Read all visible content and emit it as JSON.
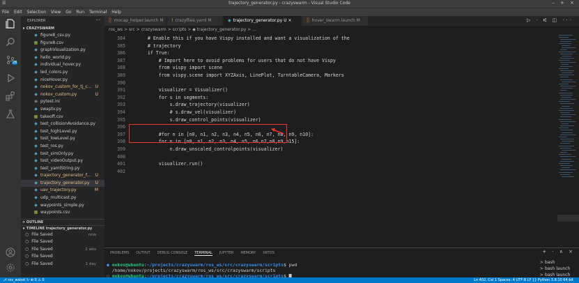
{
  "window": {
    "title": "trajectory_generator.py - crazyswarm - Visual Studio Code",
    "controls": "– + ×"
  },
  "menu": [
    "File",
    "Edit",
    "Selection",
    "View",
    "Go",
    "Run",
    "Terminal",
    "Help"
  ],
  "activity_bar": [
    "explorer-icon",
    "search-icon",
    "source-control-icon",
    "run-debug-icon",
    "extensions-icon",
    "testing-icon",
    "account-icon",
    "settings-gear-icon"
  ],
  "explorer": {
    "header": "EXPLORER",
    "more": "···",
    "root": "∨ CRAZYSWARM",
    "files": [
      {
        "name": "figure8_csv.py",
        "icon": "◆",
        "color": "#519aba",
        "badge": ""
      },
      {
        "name": "figure8.csv",
        "icon": "▦",
        "color": "#8dc149",
        "badge": ""
      },
      {
        "name": "graphVisualization.py",
        "icon": "◆",
        "color": "#519aba",
        "badge": ""
      },
      {
        "name": "hello_world.py",
        "icon": "◆",
        "color": "#519aba",
        "badge": ""
      },
      {
        "name": "individual_hover.py",
        "icon": "◆",
        "color": "#519aba",
        "badge": ""
      },
      {
        "name": "led_colors.py",
        "icon": "◆",
        "color": "#519aba",
        "badge": ""
      },
      {
        "name": "niceHover.py",
        "icon": "◆",
        "color": "#519aba",
        "badge": ""
      },
      {
        "name": "nokov_custom_for_tj_c...",
        "icon": "◆",
        "color": "#519aba",
        "badge": "U"
      },
      {
        "name": "nokov_custom.py",
        "icon": "◆",
        "color": "#519aba",
        "badge": "U"
      },
      {
        "name": "pytest.ini",
        "icon": "≡",
        "color": "#cccccc",
        "badge": ""
      },
      {
        "name": "swaptv.py",
        "icon": "◆",
        "color": "#519aba",
        "badge": ""
      },
      {
        "name": "takeoff.csv",
        "icon": "▦",
        "color": "#8dc149",
        "badge": ""
      },
      {
        "name": "test_collisionAvoidance.py",
        "icon": "◆",
        "color": "#519aba",
        "badge": ""
      },
      {
        "name": "test_highLevel.py",
        "icon": "◆",
        "color": "#519aba",
        "badge": ""
      },
      {
        "name": "test_lowLevel.py",
        "icon": "◆",
        "color": "#519aba",
        "badge": ""
      },
      {
        "name": "test_ros.py",
        "icon": "◆",
        "color": "#519aba",
        "badge": ""
      },
      {
        "name": "test_simOnly.py",
        "icon": "◆",
        "color": "#519aba",
        "badge": ""
      },
      {
        "name": "test_videoOutput.py",
        "icon": "◆",
        "color": "#519aba",
        "badge": ""
      },
      {
        "name": "test_yamlString.py",
        "icon": "◆",
        "color": "#519aba",
        "badge": ""
      },
      {
        "name": "trajectory_generator_f...",
        "icon": "◆",
        "color": "#519aba",
        "badge": "U"
      },
      {
        "name": "trajectory_generator.py",
        "icon": "◆",
        "color": "#519aba",
        "badge": "U"
      },
      {
        "name": "uav_trajectory.py",
        "icon": "◆",
        "color": "#519aba",
        "badge": "M"
      },
      {
        "name": "udp_multicast.py",
        "icon": "◆",
        "color": "#519aba",
        "badge": ""
      },
      {
        "name": "waypoints_simple.py",
        "icon": "◆",
        "color": "#519aba",
        "badge": ""
      },
      {
        "name": "waypoints.csv",
        "icon": "▦",
        "color": "#8dc149",
        "badge": ""
      }
    ],
    "outline": "> OUTLINE",
    "timeline": "∨ TIMELINE  trajectory_generator.py",
    "timeline_items": [
      {
        "label": "File Saved",
        "time": "now"
      },
      {
        "label": "File Saved",
        "time": ""
      },
      {
        "label": "File Saved",
        "time": "2 wks"
      },
      {
        "label": "File Saved",
        "time": ""
      },
      {
        "label": "File Saved",
        "time": "1 day"
      }
    ]
  },
  "tabs": [
    {
      "label": "mocap_helper.launch M",
      "icon": "░",
      "icon_color": "#e37933"
    },
    {
      "label": "crazyflies.yaml M",
      "icon": "!",
      "icon_color": "#cbcb41"
    },
    {
      "label": "trajectory_generator.py U ×",
      "icon": "◆",
      "icon_color": "#519aba"
    },
    {
      "label": "hover_swarm.launch M",
      "icon": "░",
      "icon_color": "#e37933"
    }
  ],
  "editor_actions": "▷ · ⑆ ◫ ···",
  "breadcrumb": "ros_ws > src > crazyswarm > scripts > ◆ trajectory_generator.py > ...",
  "code": [
    {
      "ln": "384",
      "indent": "    ",
      "text": "# Enable this if you have Vispy installed and want a visualization of the",
      "cls": "c-comment"
    },
    {
      "ln": "385",
      "indent": "    ",
      "text": "# trajectory",
      "cls": "c-comment"
    },
    {
      "ln": "386",
      "indent": "    ",
      "text": "if True:",
      "cls": "c-key"
    },
    {
      "ln": "387",
      "indent": "        ",
      "text": "# Import here to avoid problems for users that do not have Vispy",
      "cls": "c-comment"
    },
    {
      "ln": "388",
      "indent": "        ",
      "text": "from vispy import scene",
      "cls": "c-key"
    },
    {
      "ln": "389",
      "indent": "        ",
      "text": "from vispy.scene import XYZAxis, LinePlot, TurntableCamera, Markers",
      "cls": "c-key"
    },
    {
      "ln": "390",
      "indent": "",
      "text": "",
      "cls": ""
    },
    {
      "ln": "391",
      "indent": "        ",
      "text": "visualizer = Visualizer()",
      "cls": "c-var"
    },
    {
      "ln": "392",
      "indent": "        ",
      "text": "for s in segments:",
      "cls": "c-key"
    },
    {
      "ln": "393",
      "indent": "            ",
      "text": "s.draw_trajectory(visualizer)",
      "cls": "c-func"
    },
    {
      "ln": "394",
      "indent": "            ",
      "text": "# s.draw_vel(visualizer)",
      "cls": "c-comment"
    },
    {
      "ln": "395",
      "indent": "            ",
      "text": "s.draw_control_points(visualizer)",
      "cls": "c-func"
    },
    {
      "ln": "396",
      "indent": "",
      "text": "",
      "cls": ""
    },
    {
      "ln": "397",
      "indent": "        ",
      "text": "#for n in [n0, n1, n2, n3, n4, n5, n6, n7, n8, n9, n10]:",
      "cls": "c-comment"
    },
    {
      "ln": "398",
      "indent": "        ",
      "text": "for n in [n0, n1, n2, n3, n4, n5, n6,n7,n8,n9,n15]:",
      "cls": "c-key"
    },
    {
      "ln": "399",
      "indent": "            ",
      "text": "n.draw_unscaled_controlpoints(visualizer)",
      "cls": "c-func"
    },
    {
      "ln": "400",
      "indent": "",
      "text": "",
      "cls": ""
    },
    {
      "ln": "401",
      "indent": "        ",
      "text": "visualizer.run()",
      "cls": "c-func"
    },
    {
      "ln": "402",
      "indent": "",
      "text": "",
      "cls": ""
    }
  ],
  "panel": {
    "tabs": [
      "PROBLEMS",
      "OUTPUT",
      "DEBUG CONSOLE",
      "TERMINAL",
      "JUPYTER",
      "MEMORY",
      "XRTOS"
    ],
    "active_tab": "TERMINAL",
    "controls": "+ · ∧ ×",
    "terminal_lines": [
      {
        "user": "nokov@ubuntu",
        "path": "~/projects/crazyswarm/ros_ws/src/crazyswarm/scripts",
        "cmd": "$ pwd"
      },
      {
        "output": "/home/nokov/projects/crazyswarm/ros_ws/src/crazyswarm/scripts"
      },
      {
        "user": "nokov@ubuntu",
        "path": "~/projects/crazyswarm/ros_ws/src/crazyswarm/scripts",
        "cmd": "$ ▇"
      }
    ],
    "terminal_list": [
      "bash",
      "bash launch",
      "bash launch"
    ]
  },
  "status": {
    "left": "⎇ ros_wsbot  ↻  ⊗ 0 ⚠ 0",
    "right": "Ln 402, Col 1   Spaces: 4   UTF-8   LF   {} Python   3.8.10 64-bit"
  }
}
